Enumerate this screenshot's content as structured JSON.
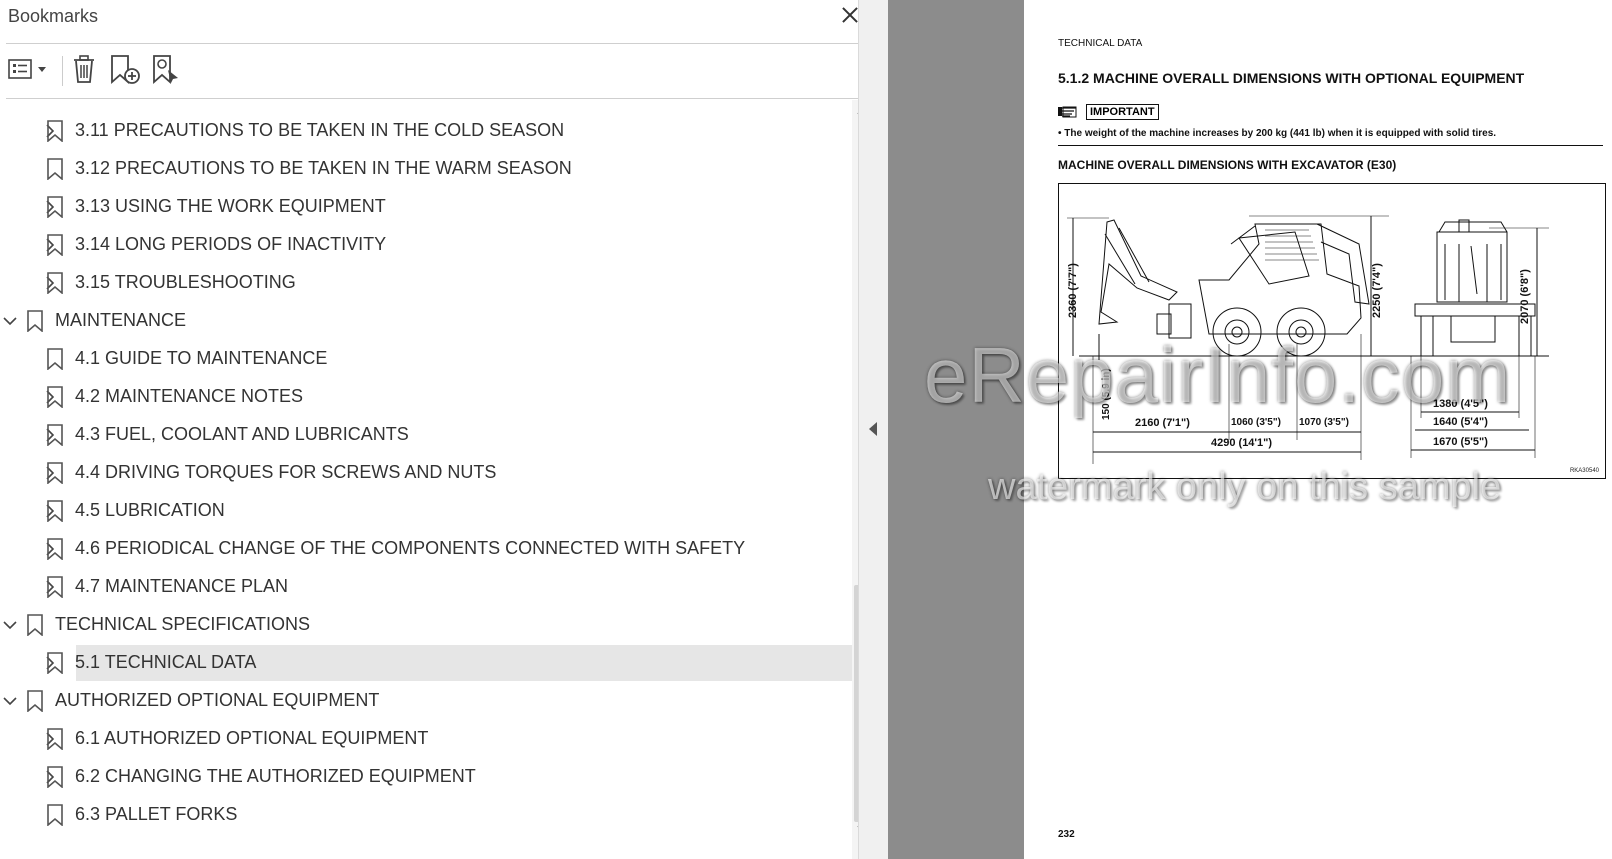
{
  "panel": {
    "title": "Bookmarks",
    "toolbar": {
      "options_icon": "list-options-icon",
      "delete_icon": "trash-icon",
      "add_icon": "add-bookmark-icon",
      "find_icon": "find-bookmark-icon"
    },
    "items": [
      {
        "label": "3.11 PRECAUTIONS TO BE TAKEN IN THE COLD SEASON",
        "level": 2,
        "expander": "collapsed"
      },
      {
        "label": "3.12 PRECAUTIONS TO BE TAKEN IN THE WARM SEASON",
        "level": 2,
        "expander": "none"
      },
      {
        "label": "3.13 USING THE WORK EQUIPMENT",
        "level": 2,
        "expander": "collapsed"
      },
      {
        "label": "3.14 LONG PERIODS OF INACTIVITY",
        "level": 2,
        "expander": "collapsed"
      },
      {
        "label": "3.15 TROUBLESHOOTING",
        "level": 2,
        "expander": "collapsed"
      },
      {
        "label": "MAINTENANCE",
        "level": 1,
        "expander": "expanded"
      },
      {
        "label": "4.1 GUIDE TO MAINTENANCE",
        "level": 2,
        "expander": "none"
      },
      {
        "label": "4.2 MAINTENANCE NOTES",
        "level": 2,
        "expander": "collapsed"
      },
      {
        "label": "4.3 FUEL, COOLANT AND LUBRICANTS",
        "level": 2,
        "expander": "collapsed"
      },
      {
        "label": "4.4 DRIVING TORQUES FOR SCREWS AND NUTS",
        "level": 2,
        "expander": "collapsed"
      },
      {
        "label": "4.5 LUBRICATION",
        "level": 2,
        "expander": "collapsed"
      },
      {
        "label": "4.6 PERIODICAL CHANGE OF THE COMPONENTS CONNECTED WITH SAFETY",
        "level": 2,
        "expander": "collapsed"
      },
      {
        "label": "4.7 MAINTENANCE PLAN",
        "level": 2,
        "expander": "collapsed"
      },
      {
        "label": "TECHNICAL SPECIFICATIONS",
        "level": 1,
        "expander": "expanded"
      },
      {
        "label": "5.1 TECHNICAL DATA",
        "level": 2,
        "expander": "collapsed",
        "selected": true
      },
      {
        "label": "AUTHORIZED OPTIONAL EQUIPMENT",
        "level": 1,
        "expander": "expanded"
      },
      {
        "label": "6.1 AUTHORIZED OPTIONAL EQUIPMENT",
        "level": 2,
        "expander": "collapsed"
      },
      {
        "label": "6.2 CHANGING THE AUTHORIZED EQUIPMENT",
        "level": 2,
        "expander": "collapsed"
      },
      {
        "label": "6.3 PALLET FORKS",
        "level": 2,
        "expander": "none"
      }
    ]
  },
  "page": {
    "section_label": "TECHNICAL DATA",
    "heading": "5.1.2  MACHINE OVERALL DIMENSIONS WITH OPTIONAL EQUIPMENT",
    "important_label": "IMPORTANT",
    "note": "• The weight of the machine increases by 200 kg (441 lb) when it is equipped with solid tires.",
    "figure_title": "MACHINE OVERALL DIMENSIONS WITH EXCAVATOR (E30)",
    "figure_code": "RKA30540",
    "dims": {
      "h2360": "2360 (7'7\")",
      "h2250": "2250 (7'4\")",
      "h2070": "2070 (6'8\")",
      "h150": "150 (5.9 in)",
      "l2160": "2160 (7'1\")",
      "l1060": "1060 (3'5\")",
      "l1070": "1070 (3'5\")",
      "l4290": "4290 (14'1\")",
      "w1380": "1380 (4'5\")",
      "w1640": "1640 (5'4\")",
      "w1670": "1670 (5'5\")"
    },
    "page_number": "232"
  },
  "watermark": {
    "line1": "eRepairInfo.com",
    "line2": "watermark only on this sample"
  }
}
